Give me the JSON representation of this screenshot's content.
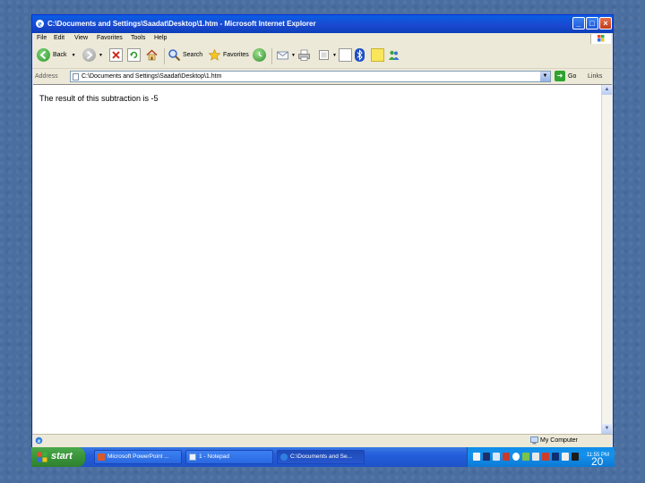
{
  "window": {
    "title": "C:\\Documents and Settings\\Saadat\\Desktop\\1.htm - Microsoft Internet Explorer",
    "buttons": {
      "minimize": "_",
      "maximize": "□",
      "close": "×"
    }
  },
  "menu": [
    "File",
    "Edit",
    "View",
    "Favorites",
    "Tools",
    "Help"
  ],
  "toolbar": {
    "back_label": "Back",
    "search_label": "Search",
    "favorites_label": "Favorites"
  },
  "address": {
    "label": "Address",
    "value": "C:\\Documents and Settings\\Saadat\\Desktop\\1.htm",
    "go_label": "Go",
    "links_label": "Links"
  },
  "content": {
    "message": "The result of this subtraction is -5"
  },
  "status": {
    "zone": "My Computer"
  },
  "taskbar": {
    "start_label": "start",
    "tasks": [
      {
        "label": "Microsoft PowerPoint ..."
      },
      {
        "label": "1 - Notepad"
      },
      {
        "label": "C:\\Documents and Se..."
      }
    ],
    "clock": "11:55 PM"
  },
  "slide_number": "20",
  "colors": {
    "titlebar": "#0a5ee4",
    "taskbar": "#245edb",
    "start": "#3a943a",
    "tray": "#1690ea",
    "chrome": "#ece9d8"
  }
}
